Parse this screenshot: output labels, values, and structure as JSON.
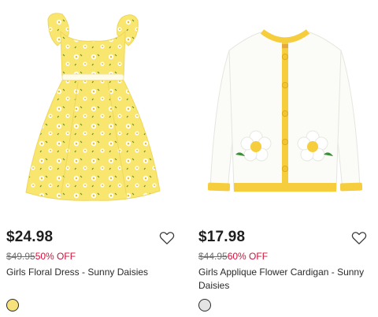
{
  "products": [
    {
      "price": "$24.98",
      "original_price": "$49.95",
      "discount": "50% OFF",
      "name": "Girls Floral Dress - Sunny Daisies",
      "swatch_color": "#f6e27a",
      "icon": "heart-outline-icon"
    },
    {
      "price": "$17.98",
      "original_price": "$44.95",
      "discount": "60% OFF",
      "name": "Girls Applique Flower Cardigan - Sunny Daisies",
      "swatch_color": "#e4e4e4",
      "icon": "heart-outline-icon"
    }
  ],
  "colors": {
    "discount_red": "#d0103a",
    "dress_yellow": "#f9e66e",
    "cardigan_trim": "#f6cd3c"
  }
}
